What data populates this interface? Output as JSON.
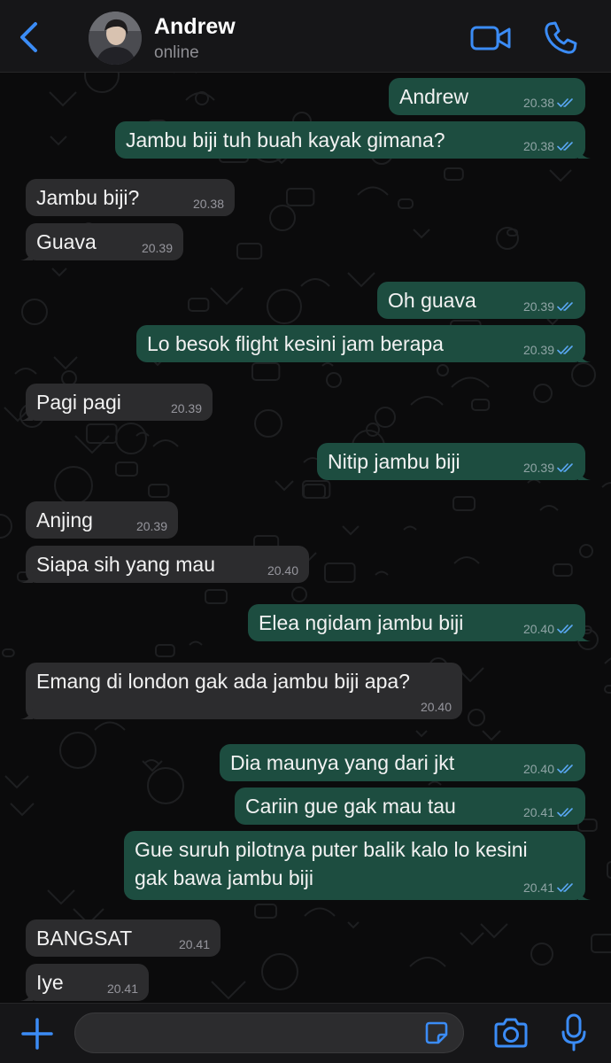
{
  "header": {
    "contact_name": "Andrew",
    "status": "online",
    "back_icon": "chevron-left-icon",
    "video_icon": "video-camera-icon",
    "call_icon": "phone-icon"
  },
  "colors": {
    "accent": "#3b8cf6",
    "outgoing_bubble": "#1d4d40",
    "incoming_bubble": "#2c2c2e",
    "read_ticks": "#5aa8f5"
  },
  "messages": [
    {
      "dir": "out",
      "text": "Andrew",
      "time": "20.38",
      "read": true
    },
    {
      "dir": "out",
      "text": "Jambu biji tuh buah kayak gimana?",
      "time": "20.38",
      "read": true
    },
    {
      "dir": "in",
      "text": "Jambu biji?",
      "time": "20.38"
    },
    {
      "dir": "in",
      "text": "Guava",
      "time": "20.39"
    },
    {
      "dir": "out",
      "text": "Oh guava",
      "time": "20.39",
      "read": true
    },
    {
      "dir": "out",
      "text": "Lo besok flight kesini jam berapa",
      "time": "20.39",
      "read": true
    },
    {
      "dir": "in",
      "text": "Pagi pagi",
      "time": "20.39"
    },
    {
      "dir": "out",
      "text": "Nitip jambu biji",
      "time": "20.39",
      "read": true
    },
    {
      "dir": "in",
      "text": "Anjing",
      "time": "20.39"
    },
    {
      "dir": "in",
      "text": "Siapa sih yang mau",
      "time": "20.40"
    },
    {
      "dir": "out",
      "text": "Elea ngidam jambu biji",
      "time": "20.40",
      "read": true
    },
    {
      "dir": "in",
      "text": "Emang di london gak ada jambu biji apa?",
      "time": "20.40"
    },
    {
      "dir": "out",
      "text": "Dia maunya yang dari jkt",
      "time": "20.40",
      "read": true
    },
    {
      "dir": "out",
      "text": "Cariin gue gak mau tau",
      "time": "20.41",
      "read": true
    },
    {
      "dir": "out",
      "text": "Gue suruh pilotnya puter balik kalo lo kesini\ngak bawa jambu biji",
      "time": "20.41",
      "read": true
    },
    {
      "dir": "in",
      "text": "BANGSAT",
      "time": "20.41"
    },
    {
      "dir": "in",
      "text": "Iye",
      "time": "20.41"
    }
  ],
  "composer": {
    "plus_icon": "plus-icon",
    "sticker_icon": "sticker-icon",
    "camera_icon": "camera-icon",
    "mic_icon": "microphone-icon"
  }
}
